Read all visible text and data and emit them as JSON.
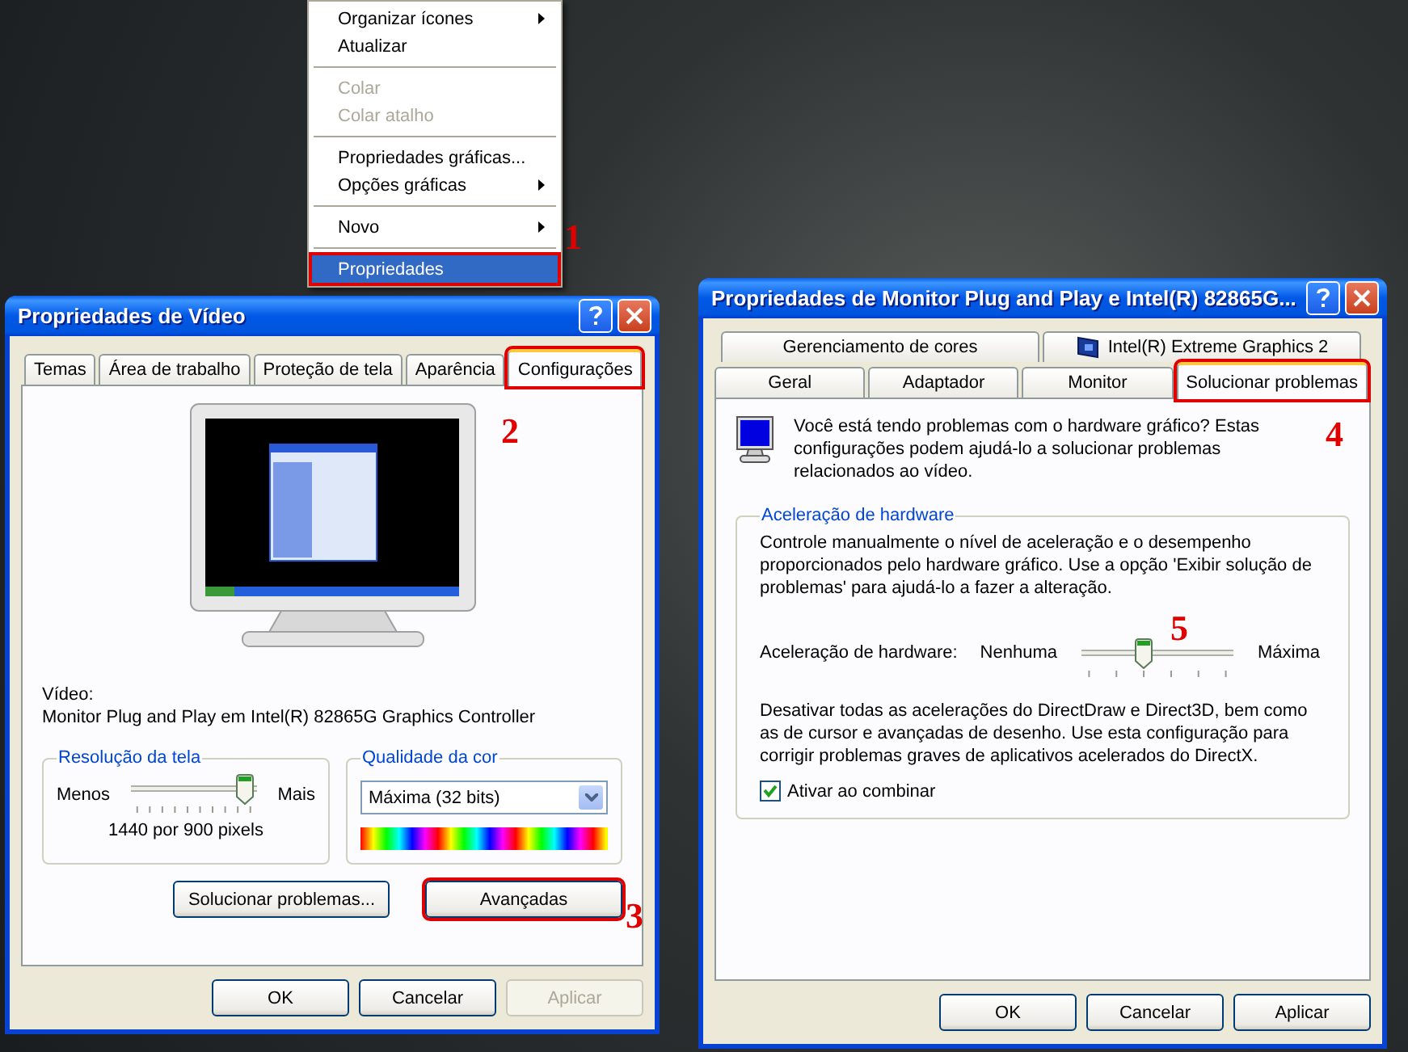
{
  "context_menu": {
    "items": [
      {
        "kind": "item",
        "label": "Organizar ícones",
        "submenu": true,
        "disabled": false,
        "selected": false,
        "outlined": false
      },
      {
        "kind": "item",
        "label": "Atualizar",
        "submenu": false,
        "disabled": false,
        "selected": false,
        "outlined": false
      },
      {
        "kind": "separator"
      },
      {
        "kind": "item",
        "label": "Colar",
        "submenu": false,
        "disabled": true,
        "selected": false,
        "outlined": false
      },
      {
        "kind": "item",
        "label": "Colar atalho",
        "submenu": false,
        "disabled": true,
        "selected": false,
        "outlined": false
      },
      {
        "kind": "separator"
      },
      {
        "kind": "item",
        "label": "Propriedades gráficas...",
        "submenu": false,
        "disabled": false,
        "selected": false,
        "outlined": false
      },
      {
        "kind": "item",
        "label": "Opções gráficas",
        "submenu": true,
        "disabled": false,
        "selected": false,
        "outlined": false
      },
      {
        "kind": "separator"
      },
      {
        "kind": "item",
        "label": "Novo",
        "submenu": true,
        "disabled": false,
        "selected": false,
        "outlined": false
      },
      {
        "kind": "separator"
      },
      {
        "kind": "item",
        "label": "Propriedades",
        "submenu": false,
        "disabled": false,
        "selected": true,
        "outlined": true
      }
    ]
  },
  "display_properties": {
    "title": "Propriedades de Vídeo",
    "tabs": [
      {
        "label": "Temas",
        "selected": false,
        "outlined": false
      },
      {
        "label": "Área de trabalho",
        "selected": false,
        "outlined": false
      },
      {
        "label": "Proteção de tela",
        "selected": false,
        "outlined": false
      },
      {
        "label": "Aparência",
        "selected": false,
        "outlined": false
      },
      {
        "label": "Configurações",
        "selected": true,
        "outlined": true
      }
    ],
    "display_label": "Vídeo:",
    "display_name": "Monitor Plug and Play em Intel(R) 82865G Graphics Controller",
    "resolution": {
      "title": "Resolução da tela",
      "min_label": "Menos",
      "max_label": "Mais",
      "level": 0.9,
      "value": "1440 por 900 pixels"
    },
    "color_quality": {
      "title": "Qualidade da cor",
      "value": "Máxima (32 bits)"
    },
    "buttons": [
      {
        "label": "Solucionar problemas...",
        "outlined": false
      },
      {
        "label": "Avançadas",
        "outlined": true
      }
    ],
    "footer_buttons": [
      {
        "label": "OK",
        "disabled": false
      },
      {
        "label": "Cancelar",
        "disabled": false
      },
      {
        "label": "Aplicar",
        "disabled": true
      }
    ]
  },
  "monitor_properties": {
    "title": "Propriedades de Monitor Plug and Play e Intel(R) 82865G...",
    "tab_rows": [
      [
        {
          "label": "Gerenciamento de cores",
          "selected": false,
          "outlined": false,
          "icon": false
        },
        {
          "label": "Intel(R) Extreme Graphics 2",
          "selected": false,
          "outlined": false,
          "icon": true
        }
      ],
      [
        {
          "label": "Geral",
          "selected": false,
          "outlined": false,
          "icon": false
        },
        {
          "label": "Adaptador",
          "selected": false,
          "outlined": false,
          "icon": false
        },
        {
          "label": "Monitor",
          "selected": false,
          "outlined": false,
          "icon": false
        },
        {
          "label": "Solucionar problemas",
          "selected": true,
          "outlined": true,
          "icon": false
        }
      ]
    ],
    "intro": " Você está tendo problemas com o hardware gráfico? Estas configurações podem ajudá-lo a solucionar problemas relacionados ao vídeo.",
    "group": {
      "title": "Aceleração de hardware",
      "description": " Controle manualmente o nível de aceleração e o desempenho proporcionados pelo hardware gráfico. Use a opção 'Exibir solução de problemas' para ajudá-lo a fazer a alteração.",
      "slider": {
        "label": "Aceleração de hardware:",
        "min_label": "Nenhuma",
        "max_label": "Máxima",
        "level": 0.4
      },
      "info": "Desativar todas as acelerações do DirectDraw e Direct3D, bem como as de cursor e avançadas de desenho. Use esta configuração para corrigir problemas graves de aplicativos acelerados do DirectX.",
      "checkbox": {
        "label": "Ativar ao combinar",
        "checked": true
      }
    },
    "footer_buttons": [
      {
        "label": "OK",
        "disabled": false
      },
      {
        "label": "Cancelar",
        "disabled": false
      },
      {
        "label": "Aplicar",
        "disabled": false
      }
    ]
  },
  "callouts": [
    "1",
    "2",
    "3",
    "4",
    "5"
  ]
}
